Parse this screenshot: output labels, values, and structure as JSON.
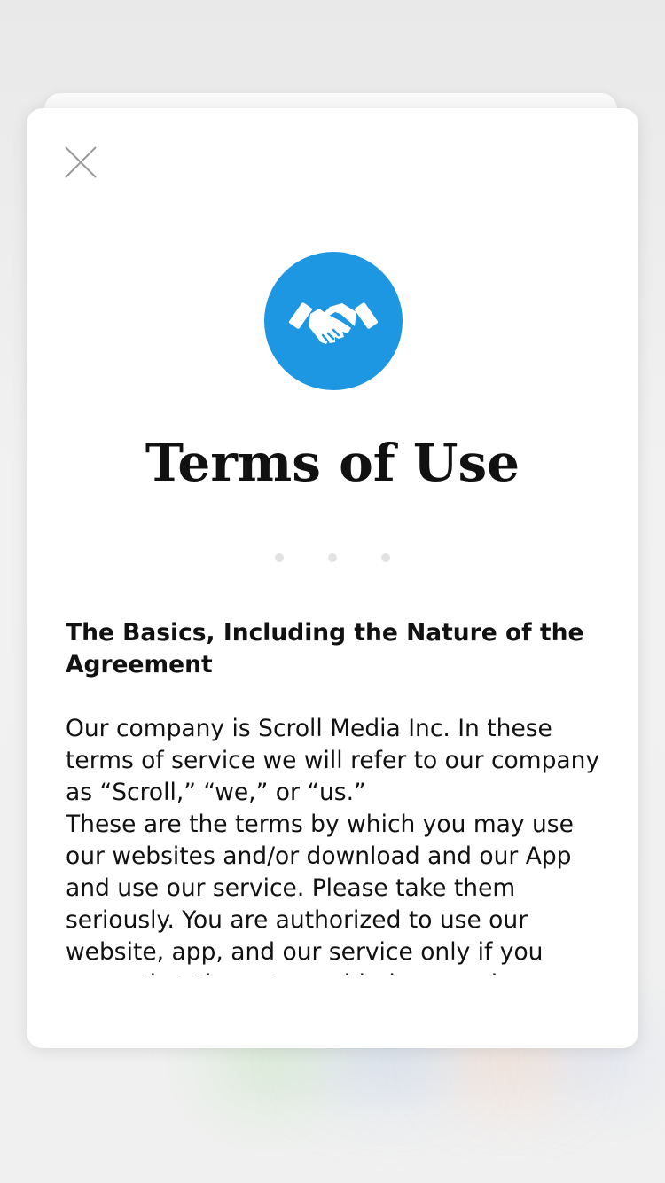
{
  "modal": {
    "close_icon": "close-icon",
    "hero_icon": "handshake-icon",
    "title": "Terms of Use",
    "pager": {
      "count": 3,
      "active_index": null
    },
    "section": {
      "heading": "The Basics, Including the Nature of the Agreement",
      "paragraph_1": "Our company is Scroll Media Inc. In these terms of service we will refer to our company as “Scroll,” “we,” or “us.”",
      "paragraph_2": "These are the terms by which you may use our websites and/or download and our App and use our service. Please take them seriously. You are authorized to use our website, app, and our service only if you agree that these terms bind you and"
    }
  },
  "colors": {
    "accent": "#1e97e3",
    "title_text": "#111111",
    "pager_dot": "#e3e3e3",
    "card_background": "#ffffff"
  }
}
